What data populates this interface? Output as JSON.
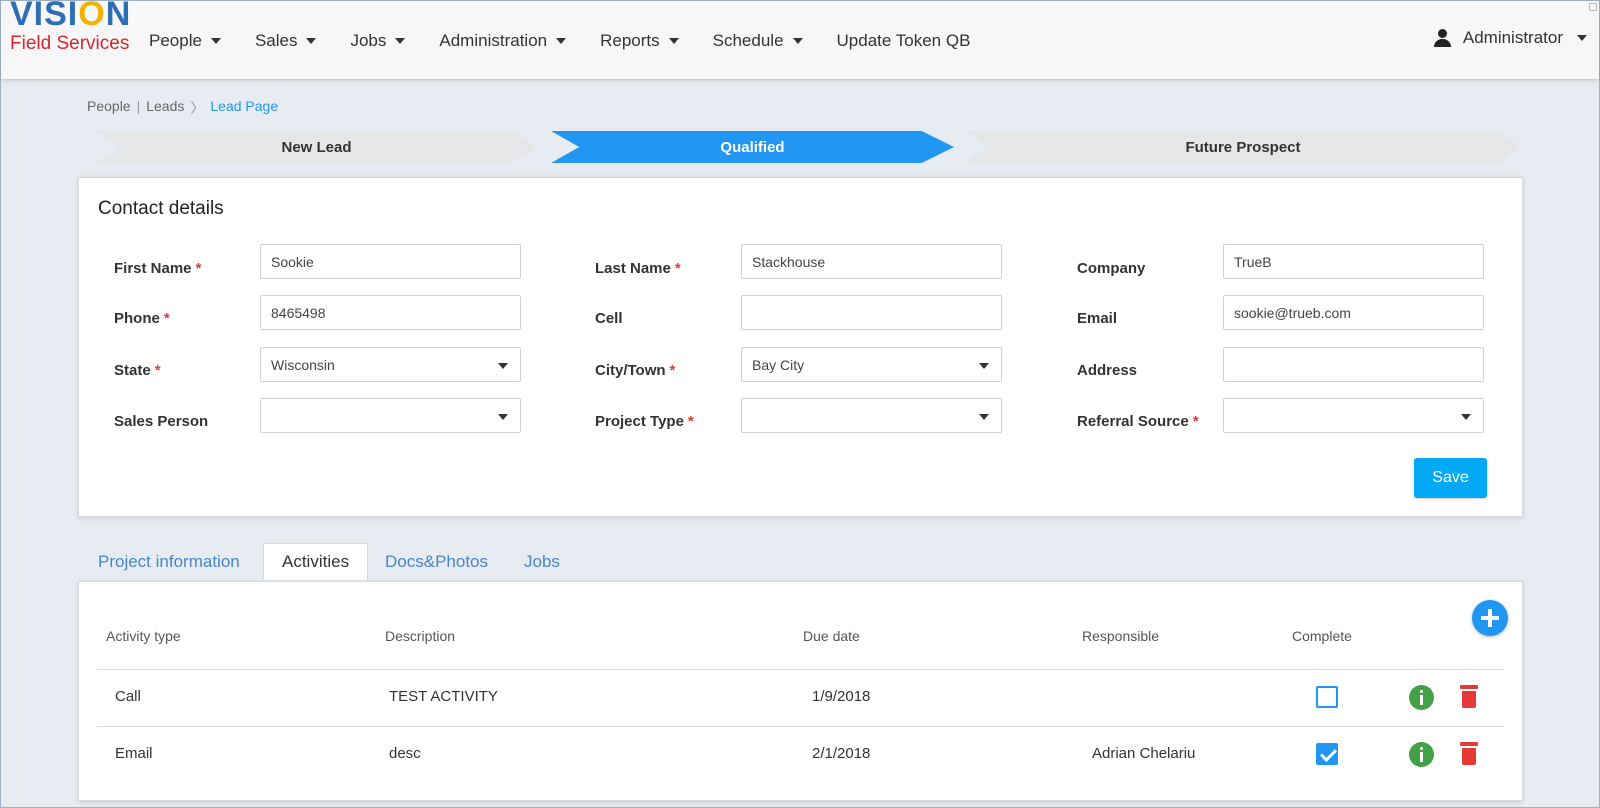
{
  "brand": {
    "line1_a": "VISI",
    "line1_b": "O",
    "line1_c": "N",
    "line2": "Field Services"
  },
  "nav": {
    "items": [
      "People",
      "Sales",
      "Jobs",
      "Administration",
      "Reports",
      "Schedule"
    ],
    "token": "Update Token QB",
    "user": "Administrator"
  },
  "breadcrumb": {
    "items": [
      "People",
      "Leads"
    ],
    "current": "Lead Page",
    "sep1": "|",
    "sep2": "〉"
  },
  "stages": {
    "new": "New Lead",
    "qualified": "Qualified",
    "future": "Future Prospect",
    "active": "Qualified"
  },
  "contact": {
    "title": "Contact details",
    "labels": {
      "first_name": "First Name",
      "last_name": "Last Name",
      "company": "Company",
      "phone": "Phone",
      "cell": "Cell",
      "email": "Email",
      "state": "State",
      "city": "City/Town",
      "address": "Address",
      "sales_person": "Sales Person",
      "project_type": "Project Type",
      "referral_source": "Referral Source"
    },
    "required_mark": "*",
    "values": {
      "first_name": "Sookie",
      "last_name": "Stackhouse",
      "company": "TrueB",
      "phone": "8465498",
      "cell": "",
      "email": "sookie@trueb.com",
      "state": "Wisconsin",
      "city": "Bay City",
      "address": "",
      "sales_person": "",
      "project_type": "",
      "referral_source": ""
    },
    "save": "Save"
  },
  "tabs": {
    "project": "Project information",
    "activities": "Activities",
    "docs": "Docs&Photos",
    "jobs": "Jobs",
    "active": "Activities"
  },
  "activities": {
    "headers": {
      "type": "Activity type",
      "description": "Description",
      "due": "Due date",
      "responsible": "Responsible",
      "complete": "Complete"
    },
    "rows": [
      {
        "type": "Call",
        "description": "TEST ACTIVITY",
        "due": "1/9/2018",
        "responsible": "",
        "complete": false
      },
      {
        "type": "Email",
        "description": "desc",
        "due": "2/1/2018",
        "responsible": "Adrian Chelariu",
        "complete": true
      }
    ]
  },
  "colors": {
    "accent": "#2196f3",
    "save": "#03a9f4",
    "required": "#e53935",
    "info": "#43a047",
    "delete": "#e53935"
  }
}
